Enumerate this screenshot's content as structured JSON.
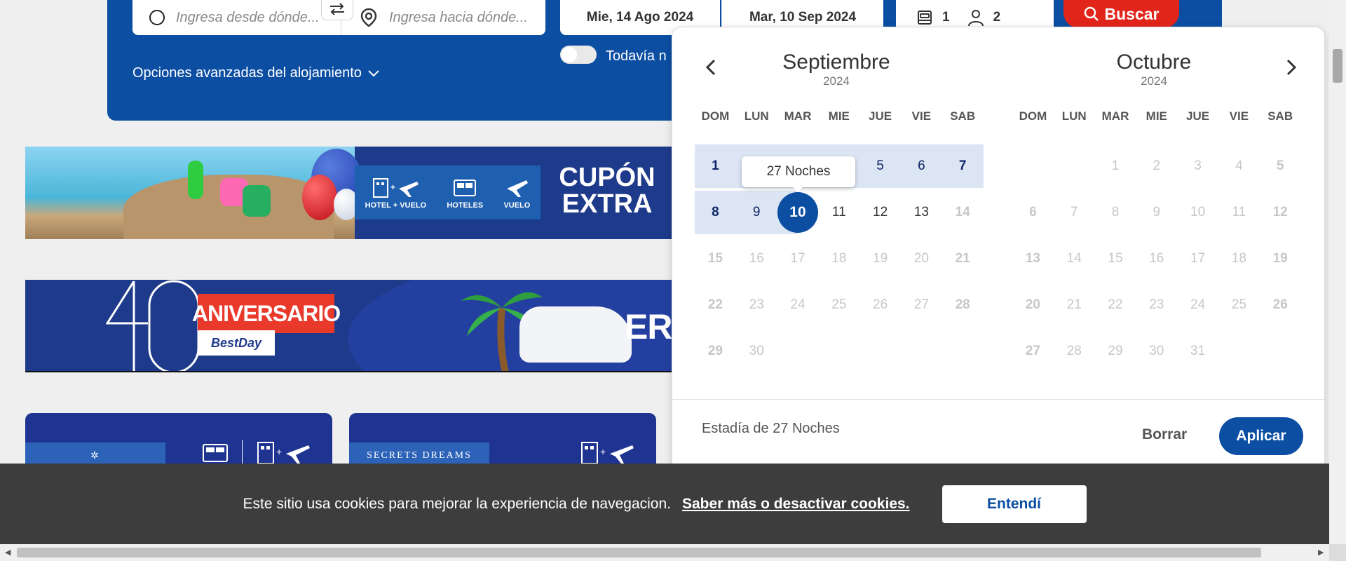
{
  "search": {
    "origin_placeholder": "Ingresa desde dónde...",
    "destination_placeholder": "Ingresa hacia dónde...",
    "date_start": "Mie, 14 Ago 2024",
    "date_end": "Mar, 10 Sep 2024",
    "rooms": "1",
    "adults": "2",
    "search_label": "Buscar",
    "advanced_options": "Opciones avanzadas del alojamiento",
    "toggle_label": "Todavía n"
  },
  "banners": {
    "banner1": {
      "products": [
        "HOTEL + VUELO",
        "HOTELES",
        "VUELO"
      ],
      "cupon_line1": "CUPÓN",
      "cupon_line2": "EXTRA"
    },
    "banner2": {
      "ribbon": "ANIVERSARIO",
      "brand": "BestDay",
      "partial_text": "EROS"
    },
    "cards": [
      {
        "brand": "✲"
      },
      {
        "brand": "SECRETS DREAMS"
      }
    ]
  },
  "calendar": {
    "months": [
      {
        "name": "Septiembre",
        "year": "2024"
      },
      {
        "name": "Octubre",
        "year": "2024"
      }
    ],
    "weekdays": [
      "DOM",
      "LUN",
      "MAR",
      "MIE",
      "JUE",
      "VIE",
      "SAB"
    ],
    "tooltip": "27 Noches",
    "stay_text": "Estadía de 27 Noches",
    "clear_label": "Borrar",
    "apply_label": "Aplicar",
    "selected_day": "10"
  },
  "cookie": {
    "message": "Este sitio usa cookies para mejorar la experiencia de navegacion.",
    "link": "Saber más o desactivar cookies.",
    "accept_label": "Entendí"
  },
  "colors": {
    "primary": "#0b4ea2",
    "search_button": "#e1251b",
    "range_bg": "#dbe5f3",
    "cookie_bg": "#3d3d3d"
  }
}
